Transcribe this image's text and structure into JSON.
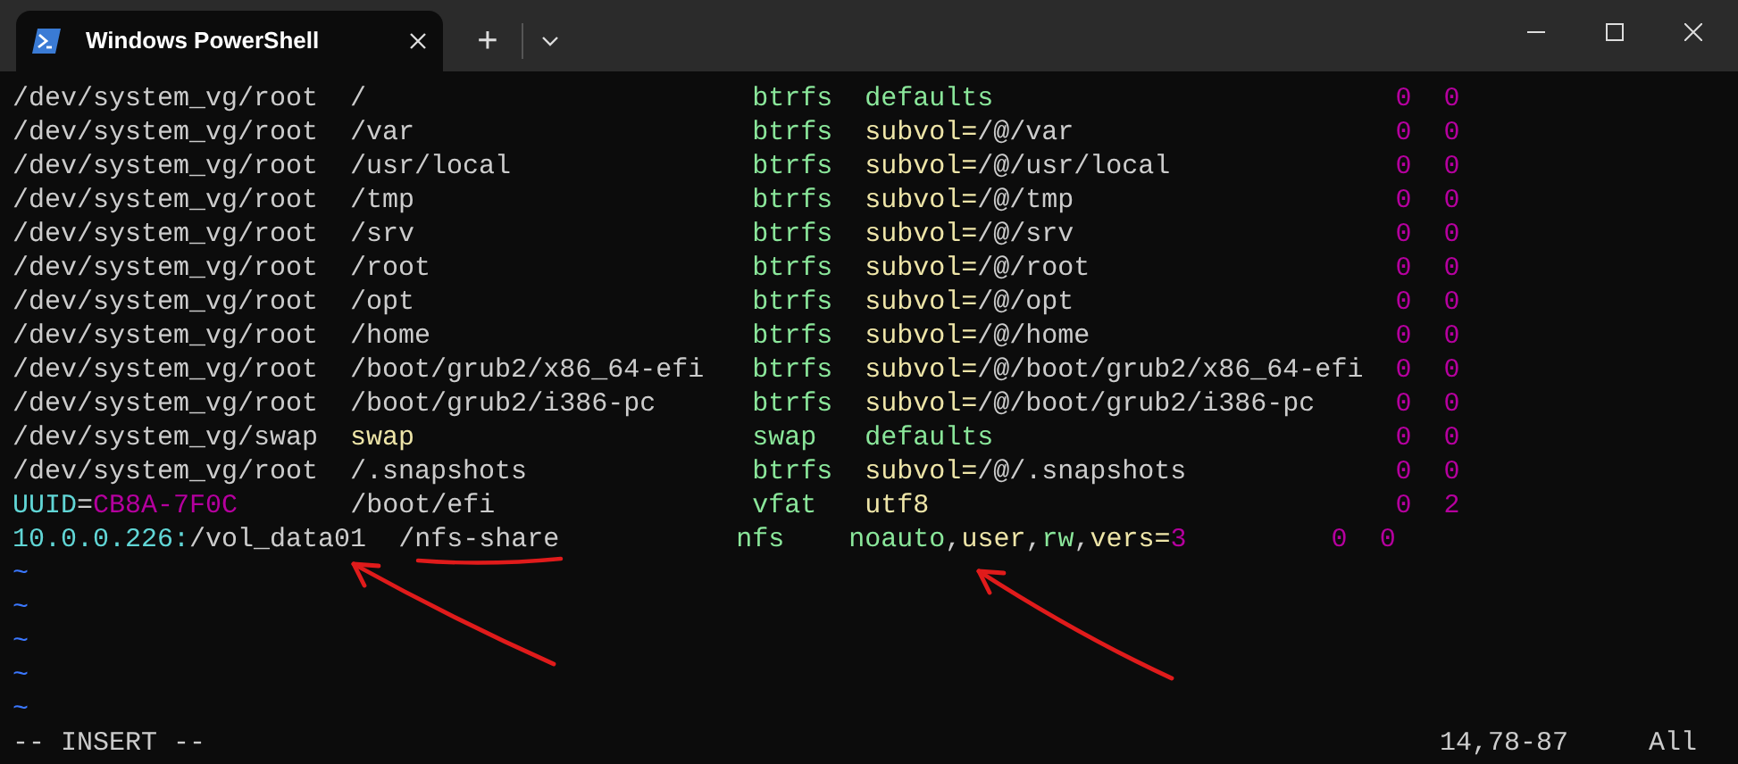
{
  "window": {
    "tab_title": "Windows PowerShell",
    "new_tab": "+"
  },
  "lines": [
    [
      {
        "text": "/dev/system_vg/root  ",
        "kind": "plain"
      },
      {
        "text": "/                        ",
        "kind": "plain"
      },
      {
        "text": "btrfs  ",
        "kind": "green"
      },
      {
        "text": "defaults                         ",
        "kind": "green"
      },
      {
        "text": "0  ",
        "kind": "number"
      },
      {
        "text": "0",
        "kind": "number"
      }
    ],
    [
      {
        "text": "/dev/system_vg/root  ",
        "kind": "plain"
      },
      {
        "text": "/var                     ",
        "kind": "plain"
      },
      {
        "text": "btrfs  ",
        "kind": "green"
      },
      {
        "text": "subvol=",
        "kind": "yellow"
      },
      {
        "text": "/@/var                    ",
        "kind": "plain"
      },
      {
        "text": "0  ",
        "kind": "number"
      },
      {
        "text": "0",
        "kind": "number"
      }
    ],
    [
      {
        "text": "/dev/system_vg/root  ",
        "kind": "plain"
      },
      {
        "text": "/usr/local               ",
        "kind": "plain"
      },
      {
        "text": "btrfs  ",
        "kind": "green"
      },
      {
        "text": "subvol=",
        "kind": "yellow"
      },
      {
        "text": "/@/usr/local              ",
        "kind": "plain"
      },
      {
        "text": "0  ",
        "kind": "number"
      },
      {
        "text": "0",
        "kind": "number"
      }
    ],
    [
      {
        "text": "/dev/system_vg/root  ",
        "kind": "plain"
      },
      {
        "text": "/tmp                     ",
        "kind": "plain"
      },
      {
        "text": "btrfs  ",
        "kind": "green"
      },
      {
        "text": "subvol=",
        "kind": "yellow"
      },
      {
        "text": "/@/tmp                    ",
        "kind": "plain"
      },
      {
        "text": "0  ",
        "kind": "number"
      },
      {
        "text": "0",
        "kind": "number"
      }
    ],
    [
      {
        "text": "/dev/system_vg/root  ",
        "kind": "plain"
      },
      {
        "text": "/srv                     ",
        "kind": "plain"
      },
      {
        "text": "btrfs  ",
        "kind": "green"
      },
      {
        "text": "subvol=",
        "kind": "yellow"
      },
      {
        "text": "/@/srv                    ",
        "kind": "plain"
      },
      {
        "text": "0  ",
        "kind": "number"
      },
      {
        "text": "0",
        "kind": "number"
      }
    ],
    [
      {
        "text": "/dev/system_vg/root  ",
        "kind": "plain"
      },
      {
        "text": "/root                    ",
        "kind": "plain"
      },
      {
        "text": "btrfs  ",
        "kind": "green"
      },
      {
        "text": "subvol=",
        "kind": "yellow"
      },
      {
        "text": "/@/root                   ",
        "kind": "plain"
      },
      {
        "text": "0  ",
        "kind": "number"
      },
      {
        "text": "0",
        "kind": "number"
      }
    ],
    [
      {
        "text": "/dev/system_vg/root  ",
        "kind": "plain"
      },
      {
        "text": "/opt                     ",
        "kind": "plain"
      },
      {
        "text": "btrfs  ",
        "kind": "green"
      },
      {
        "text": "subvol=",
        "kind": "yellow"
      },
      {
        "text": "/@/opt                    ",
        "kind": "plain"
      },
      {
        "text": "0  ",
        "kind": "number"
      },
      {
        "text": "0",
        "kind": "number"
      }
    ],
    [
      {
        "text": "/dev/system_vg/root  ",
        "kind": "plain"
      },
      {
        "text": "/home                    ",
        "kind": "plain"
      },
      {
        "text": "btrfs  ",
        "kind": "green"
      },
      {
        "text": "subvol=",
        "kind": "yellow"
      },
      {
        "text": "/@/home                   ",
        "kind": "plain"
      },
      {
        "text": "0  ",
        "kind": "number"
      },
      {
        "text": "0",
        "kind": "number"
      }
    ],
    [
      {
        "text": "/dev/system_vg/root  ",
        "kind": "plain"
      },
      {
        "text": "/boot/grub2/x86_64-efi   ",
        "kind": "plain"
      },
      {
        "text": "btrfs  ",
        "kind": "green"
      },
      {
        "text": "subvol=",
        "kind": "yellow"
      },
      {
        "text": "/@/boot/grub2/x86_64-efi  ",
        "kind": "plain"
      },
      {
        "text": "0  ",
        "kind": "number"
      },
      {
        "text": "0",
        "kind": "number"
      }
    ],
    [
      {
        "text": "/dev/system_vg/root  ",
        "kind": "plain"
      },
      {
        "text": "/boot/grub2/i386-pc      ",
        "kind": "plain"
      },
      {
        "text": "btrfs  ",
        "kind": "green"
      },
      {
        "text": "subvol=",
        "kind": "yellow"
      },
      {
        "text": "/@/boot/grub2/i386-pc     ",
        "kind": "plain"
      },
      {
        "text": "0  ",
        "kind": "number"
      },
      {
        "text": "0",
        "kind": "number"
      }
    ],
    [
      {
        "text": "/dev/system_vg/swap  ",
        "kind": "plain"
      },
      {
        "text": "swap                     ",
        "kind": "yellow"
      },
      {
        "text": "swap   ",
        "kind": "green"
      },
      {
        "text": "defaults                         ",
        "kind": "green"
      },
      {
        "text": "0  ",
        "kind": "number"
      },
      {
        "text": "0",
        "kind": "number"
      }
    ],
    [
      {
        "text": "/dev/system_vg/root  ",
        "kind": "plain"
      },
      {
        "text": "/.snapshots              ",
        "kind": "plain"
      },
      {
        "text": "btrfs  ",
        "kind": "green"
      },
      {
        "text": "subvol=",
        "kind": "yellow"
      },
      {
        "text": "/@/.snapshots             ",
        "kind": "plain"
      },
      {
        "text": "0  ",
        "kind": "number"
      },
      {
        "text": "0",
        "kind": "number"
      }
    ],
    [
      {
        "text": "UUID",
        "kind": "cyan"
      },
      {
        "text": "=",
        "kind": "plain"
      },
      {
        "text": "CB8A-7F0C       ",
        "kind": "number"
      },
      {
        "text": "/boot/efi                ",
        "kind": "plain"
      },
      {
        "text": "vfat   ",
        "kind": "green"
      },
      {
        "text": "utf8                             ",
        "kind": "yellow"
      },
      {
        "text": "0  ",
        "kind": "number"
      },
      {
        "text": "2",
        "kind": "number"
      }
    ],
    [
      {
        "text": "10.0.0.226:",
        "kind": "cyan"
      },
      {
        "text": "/vol_data01  ",
        "kind": "plain"
      },
      {
        "text": "/nfs-share           ",
        "kind": "plain"
      },
      {
        "text": "nfs    ",
        "kind": "green"
      },
      {
        "text": "noauto",
        "kind": "green"
      },
      {
        "text": ",",
        "kind": "plain"
      },
      {
        "text": "user",
        "kind": "yellow"
      },
      {
        "text": ",",
        "kind": "plain"
      },
      {
        "text": "rw",
        "kind": "green"
      },
      {
        "text": ",",
        "kind": "plain"
      },
      {
        "text": "vers=",
        "kind": "yellow"
      },
      {
        "text": "3         ",
        "kind": "number"
      },
      {
        "text": "0  ",
        "kind": "number"
      },
      {
        "text": "0",
        "kind": "number"
      }
    ]
  ],
  "tildes": [
    "~",
    "~",
    "~",
    "~",
    "~"
  ],
  "status": {
    "mode": "-- INSERT --",
    "position": "14,78-87",
    "scroll": "All"
  }
}
